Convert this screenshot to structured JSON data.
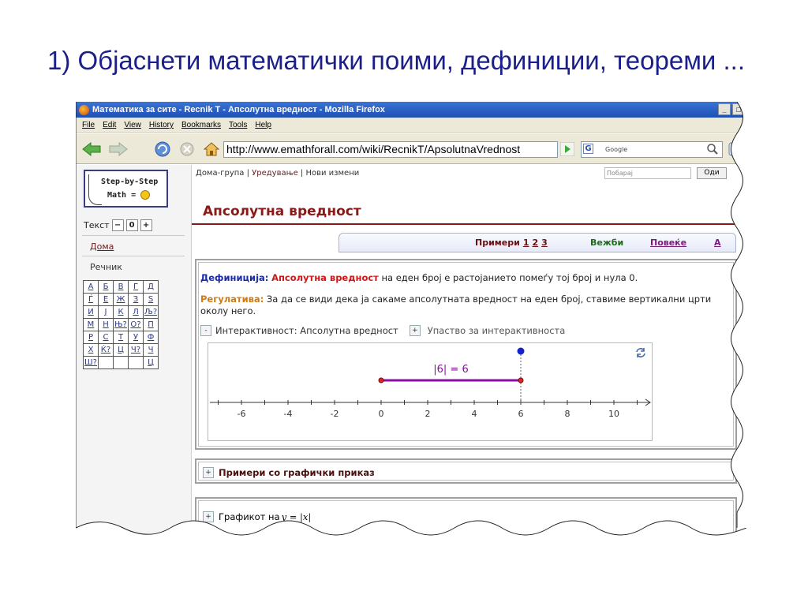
{
  "slide": {
    "title": "1) Објаснети математички поими, дефиниции, теореми ..."
  },
  "window": {
    "title": "Математика за сите - Recnik T - Апсолутна вредност - Mozilla Firefox",
    "controls": {
      "minimize": "_",
      "maximize": "□"
    }
  },
  "menu": [
    "File",
    "Edit",
    "View",
    "History",
    "Bookmarks",
    "Tools",
    "Help"
  ],
  "toolbar": {
    "url": "http://www.emathforall.com/wiki/RecnikT/ApsolutnaVrednost",
    "search_placeholder": "Google",
    "search_engine_letter": "G"
  },
  "sidebar": {
    "logo_line1": "Step-by-Step",
    "logo_line2": "Math =",
    "text_label": "Текст",
    "text_minus": "−",
    "text_value": "0",
    "text_plus": "+",
    "home_link": "Дома",
    "dictionary_label": "Речник",
    "alphabet": [
      [
        "А",
        "Б",
        "В",
        "Г",
        "Д"
      ],
      [
        "Ѓ",
        "Е",
        "Ж",
        "З",
        "Ѕ"
      ],
      [
        "И",
        "Ј",
        "К",
        "Л",
        "Љ?"
      ],
      [
        "М",
        "Н",
        "Њ?",
        "О?",
        "П"
      ],
      [
        "Р",
        "С",
        "Т",
        "У",
        "Ф"
      ],
      [
        "Х",
        "Ќ?",
        "Ц",
        "Ч?",
        "Ч"
      ],
      [
        "Ш?",
        "",
        "",
        "",
        "Ц"
      ]
    ]
  },
  "page": {
    "topnav": {
      "group": "Дома-група",
      "edit": "Уредување",
      "changes": "Нови измени",
      "sep": " | "
    },
    "search_placeholder": "Побарај",
    "search_button": "Оди",
    "heading": "Апсолутна вредност",
    "tabs": {
      "examples_label": "Примери",
      "examples_numbers": [
        "1",
        "2",
        "3"
      ],
      "exercises": "Вежби",
      "more": "Повеќе",
      "a": "А"
    },
    "definition": {
      "label": "Дефиниција:",
      "term": "Апсолутна вредност",
      "text": " на еден број е растојанието помеѓу тој број и нула 0."
    },
    "regulation": {
      "label": "Регулатива:",
      "text": " За да се види дека ја сакаме апсолутната вредност на еден број, ставиме вертикални црти околу него."
    },
    "interactivity": {
      "toggle": "-",
      "label": "Интерактивност: Апсолутна вредност",
      "guide_toggle": "+",
      "guide_label": "Упаство за интерактивноста"
    },
    "applet": {
      "ticks": [
        "-6",
        "-4",
        "-2",
        "0",
        "2",
        "4",
        "6",
        "8",
        "10"
      ],
      "expression": "|6| = 6",
      "point_value": 6,
      "colors": {
        "segment": "#8b0f9e",
        "point": "#1521c9",
        "endpoint": "#d62b2b"
      }
    },
    "sections": [
      {
        "toggle": "+",
        "label": "Примери со графички приказ"
      },
      {
        "toggle": "+",
        "label": "Графикот на ",
        "math": "y = |x|"
      }
    ]
  }
}
